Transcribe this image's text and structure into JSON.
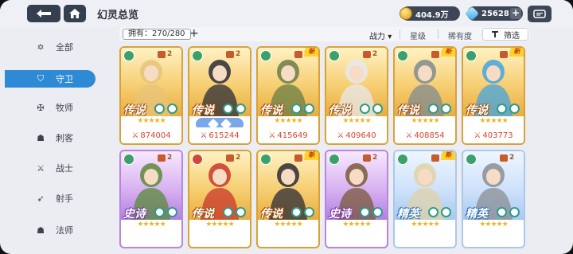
{
  "header": {
    "title": "幻灵总览",
    "gold": "404.9万",
    "gems": "25628"
  },
  "sidebar": {
    "items": [
      {
        "label": "全部",
        "icon": "all-icon",
        "glyph": "✡"
      },
      {
        "label": "守卫",
        "icon": "shield-icon",
        "glyph": "⛉",
        "active": true
      },
      {
        "label": "牧师",
        "icon": "priest-icon",
        "glyph": "✠"
      },
      {
        "label": "刺客",
        "icon": "assassin-icon",
        "glyph": "☗"
      },
      {
        "label": "战士",
        "icon": "warrior-icon",
        "glyph": "⚔"
      },
      {
        "label": "射手",
        "icon": "archer-icon",
        "glyph": "➶"
      },
      {
        "label": "法师",
        "icon": "mage-icon",
        "glyph": "☗"
      }
    ]
  },
  "filter": {
    "owned_label": "拥有：270/280",
    "power": "战力",
    "star": "星级",
    "rarity": "稀有度",
    "filter": "筛选"
  },
  "cards": [
    {
      "rarity": "传说",
      "tier": "gold",
      "level": "2",
      "power": "874004",
      "stars": "★★★★★",
      "is_new": false,
      "elem": "#3da06a",
      "hue": "#e7c37a"
    },
    {
      "rarity": "传说",
      "tier": "gold",
      "level": "2",
      "power": "615244",
      "stars": "",
      "is_new": false,
      "elem": "#3da06a",
      "hue": "#2b2b36",
      "pill": true
    },
    {
      "rarity": "传说",
      "tier": "gold",
      "level": "2",
      "power": "415649",
      "stars": "★★★★★",
      "is_new": true,
      "elem": "#3da06a",
      "hue": "#6a7d45"
    },
    {
      "rarity": "传说",
      "tier": "gold",
      "level": "2",
      "power": "409640",
      "stars": "★★★★★",
      "is_new": false,
      "elem": "#3da06a",
      "hue": "#e8e8ee"
    },
    {
      "rarity": "传说",
      "tier": "gold",
      "level": "2",
      "power": "408854",
      "stars": "★★★★★",
      "is_new": true,
      "elem": "#3da06a",
      "hue": "#7f8b90"
    },
    {
      "rarity": "传说",
      "tier": "gold",
      "level": "2",
      "power": "403773",
      "stars": "★★★★★",
      "is_new": true,
      "elem": "#3da06a",
      "hue": "#44a4e0"
    },
    {
      "rarity": "史诗",
      "tier": "purple",
      "level": "2",
      "power": "",
      "stars": "★★★★★",
      "is_new": false,
      "elem": "#3da06a",
      "hue": "#5a8a3a"
    },
    {
      "rarity": "传说",
      "tier": "gold",
      "level": "2",
      "power": "",
      "stars": "★★★★★",
      "is_new": false,
      "elem": "#d0483a",
      "hue": "#c8372c"
    },
    {
      "rarity": "传说",
      "tier": "gold",
      "level": "2",
      "power": "",
      "stars": "★★★★★",
      "is_new": true,
      "elem": "#3da06a",
      "hue": "#2b2b36"
    },
    {
      "rarity": "史诗",
      "tier": "purple",
      "level": "2",
      "power": "",
      "stars": "★★★★★",
      "is_new": false,
      "elem": "#3da06a",
      "hue": "#7a5a3a"
    },
    {
      "rarity": "精英",
      "tier": "blue",
      "level": "2",
      "power": "",
      "stars": "★★★★★",
      "is_new": true,
      "elem": "#3da06a",
      "hue": "#e0d2a8"
    },
    {
      "rarity": "精英",
      "tier": "blue",
      "level": "2",
      "power": "",
      "stars": "★★★★★",
      "is_new": false,
      "elem": "#3da06a",
      "hue": "#8a8d94"
    }
  ]
}
